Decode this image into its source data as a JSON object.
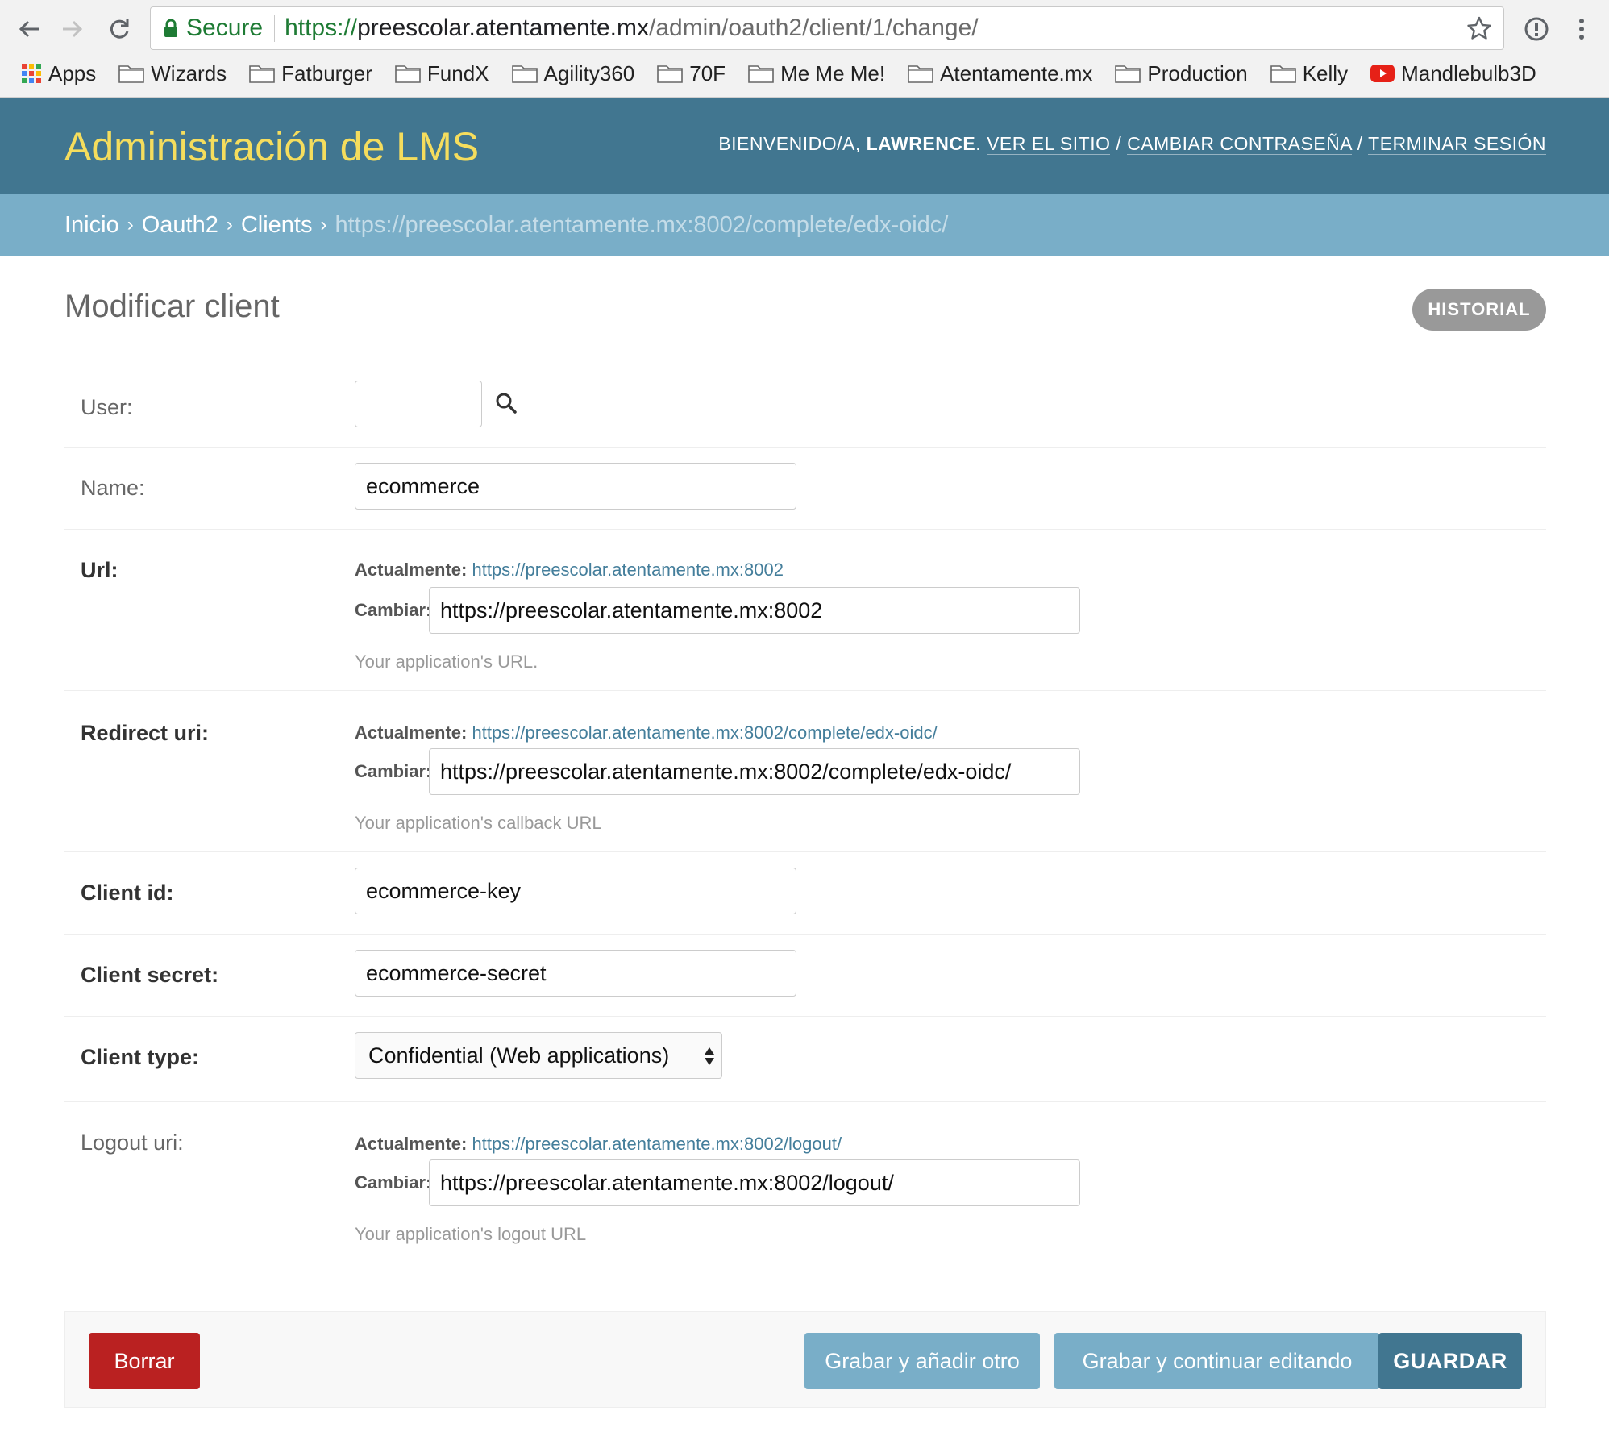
{
  "browser": {
    "secure_label": "Secure",
    "url_scheme": "https://",
    "url_host": "preescolar.atentamente.mx",
    "url_path": "/admin/oauth2/client/1/change/",
    "bookmarks": [
      "Apps",
      "Wizards",
      "Fatburger",
      "FundX",
      "Agility360",
      "70F",
      "Me Me Me!",
      "Atentamente.mx",
      "Production",
      "Kelly",
      "Mandlebulb3D"
    ]
  },
  "header": {
    "brand": "Administración de LMS",
    "welcome": "BIENVENIDO/A,",
    "username": "LAWRENCE",
    "dot": ".",
    "view_site": "VER EL SITIO",
    "change_password": "CAMBIAR CONTRASEÑA",
    "logout": "TERMINAR SESIÓN",
    "slash": "/"
  },
  "breadcrumbs": {
    "home": "Inicio",
    "app": "Oauth2",
    "model": "Clients",
    "current": "https://preescolar.atentamente.mx:8002/complete/edx-oidc/",
    "separator": "›"
  },
  "content": {
    "title": "Modificar client",
    "history_button": "HISTORIAL"
  },
  "form": {
    "currently_label": "Actualmente:",
    "change_label": "Cambiar:",
    "user": {
      "label": "User:",
      "value": ""
    },
    "name": {
      "label": "Name:",
      "value": "ecommerce"
    },
    "url": {
      "label": "Url:",
      "current": "https://preescolar.atentamente.mx:8002",
      "value": "https://preescolar.atentamente.mx:8002",
      "help": "Your application's URL."
    },
    "redirect_uri": {
      "label": "Redirect uri:",
      "current": "https://preescolar.atentamente.mx:8002/complete/edx-oidc/",
      "value": "https://preescolar.atentamente.mx:8002/complete/edx-oidc/",
      "help": "Your application's callback URL"
    },
    "client_id": {
      "label": "Client id:",
      "value": "ecommerce-key"
    },
    "client_secret": {
      "label": "Client secret:",
      "value": "ecommerce-secret"
    },
    "client_type": {
      "label": "Client type:",
      "value": "Confidential (Web applications)"
    },
    "logout_uri": {
      "label": "Logout uri:",
      "current": "https://preescolar.atentamente.mx:8002/logout/",
      "value": "https://preescolar.atentamente.mx:8002/logout/",
      "help": "Your application's logout URL"
    }
  },
  "actions": {
    "delete": "Borrar",
    "save_add_another": "Grabar y añadir otro",
    "save_continue": "Grabar y continuar editando",
    "save": "GUARDAR"
  },
  "colors": {
    "header_bg": "#417690",
    "breadcrumb_bg": "#79aec8",
    "brand_text": "#f5dd5d",
    "delete_bg": "#ba2121",
    "link": "#447e9b"
  }
}
